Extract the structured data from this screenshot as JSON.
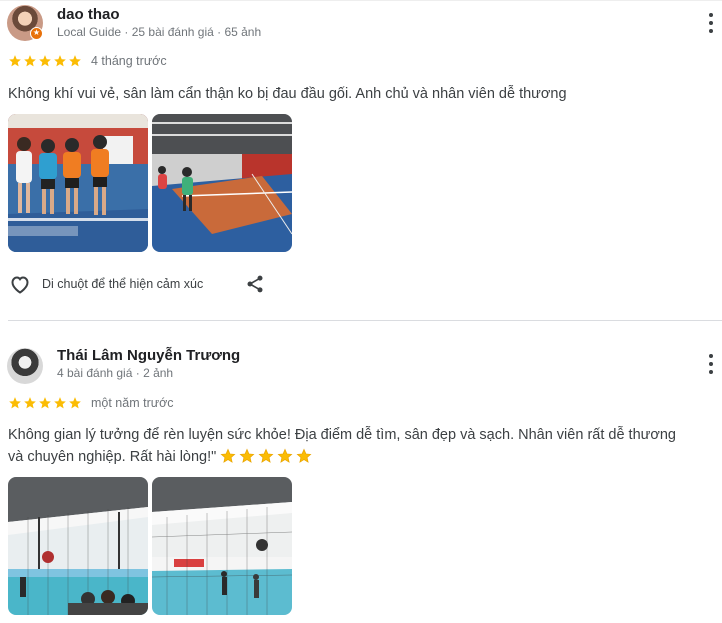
{
  "reviews": [
    {
      "author": "dao thao",
      "meta": "Local Guide · 25 bài đánh giá · 65 ảnh",
      "rating": 5,
      "time": "4 tháng trước",
      "text": "Không khí vui vẻ, sân làm cẩn thận ko bị đau đầu gối. Anh chủ và nhân viên dễ thương",
      "photos": [
        "group-photo",
        "court-play-photo"
      ],
      "react_label": "Di chuột để thể hiện cảm xúc"
    },
    {
      "author": "Thái Lâm Nguyễn Trương",
      "meta": "4 bài đánh giá · 2 ảnh",
      "rating": 5,
      "time": "một năm trước",
      "text_line1": "Không gian lý tưởng để rèn luyện sức khỏe! Địa điểm dễ tìm, sân đẹp và sạch. Nhân viên rất dễ thương",
      "text_line2": "và chuyên nghiệp. Rất hài lòng!\"",
      "emoji_stars": 5,
      "photos": [
        "indoor-court-photo",
        "indoor-court-photo-2"
      ]
    }
  ],
  "colors": {
    "star": "#fbbc04",
    "muted": "#70757a",
    "divider": "#dadce0",
    "badge": "#e8710a"
  },
  "icons": {
    "menu": "more-vert-icon",
    "react": "heart-outline-icon",
    "share": "share-icon",
    "guide": "local-guide-badge-icon"
  }
}
